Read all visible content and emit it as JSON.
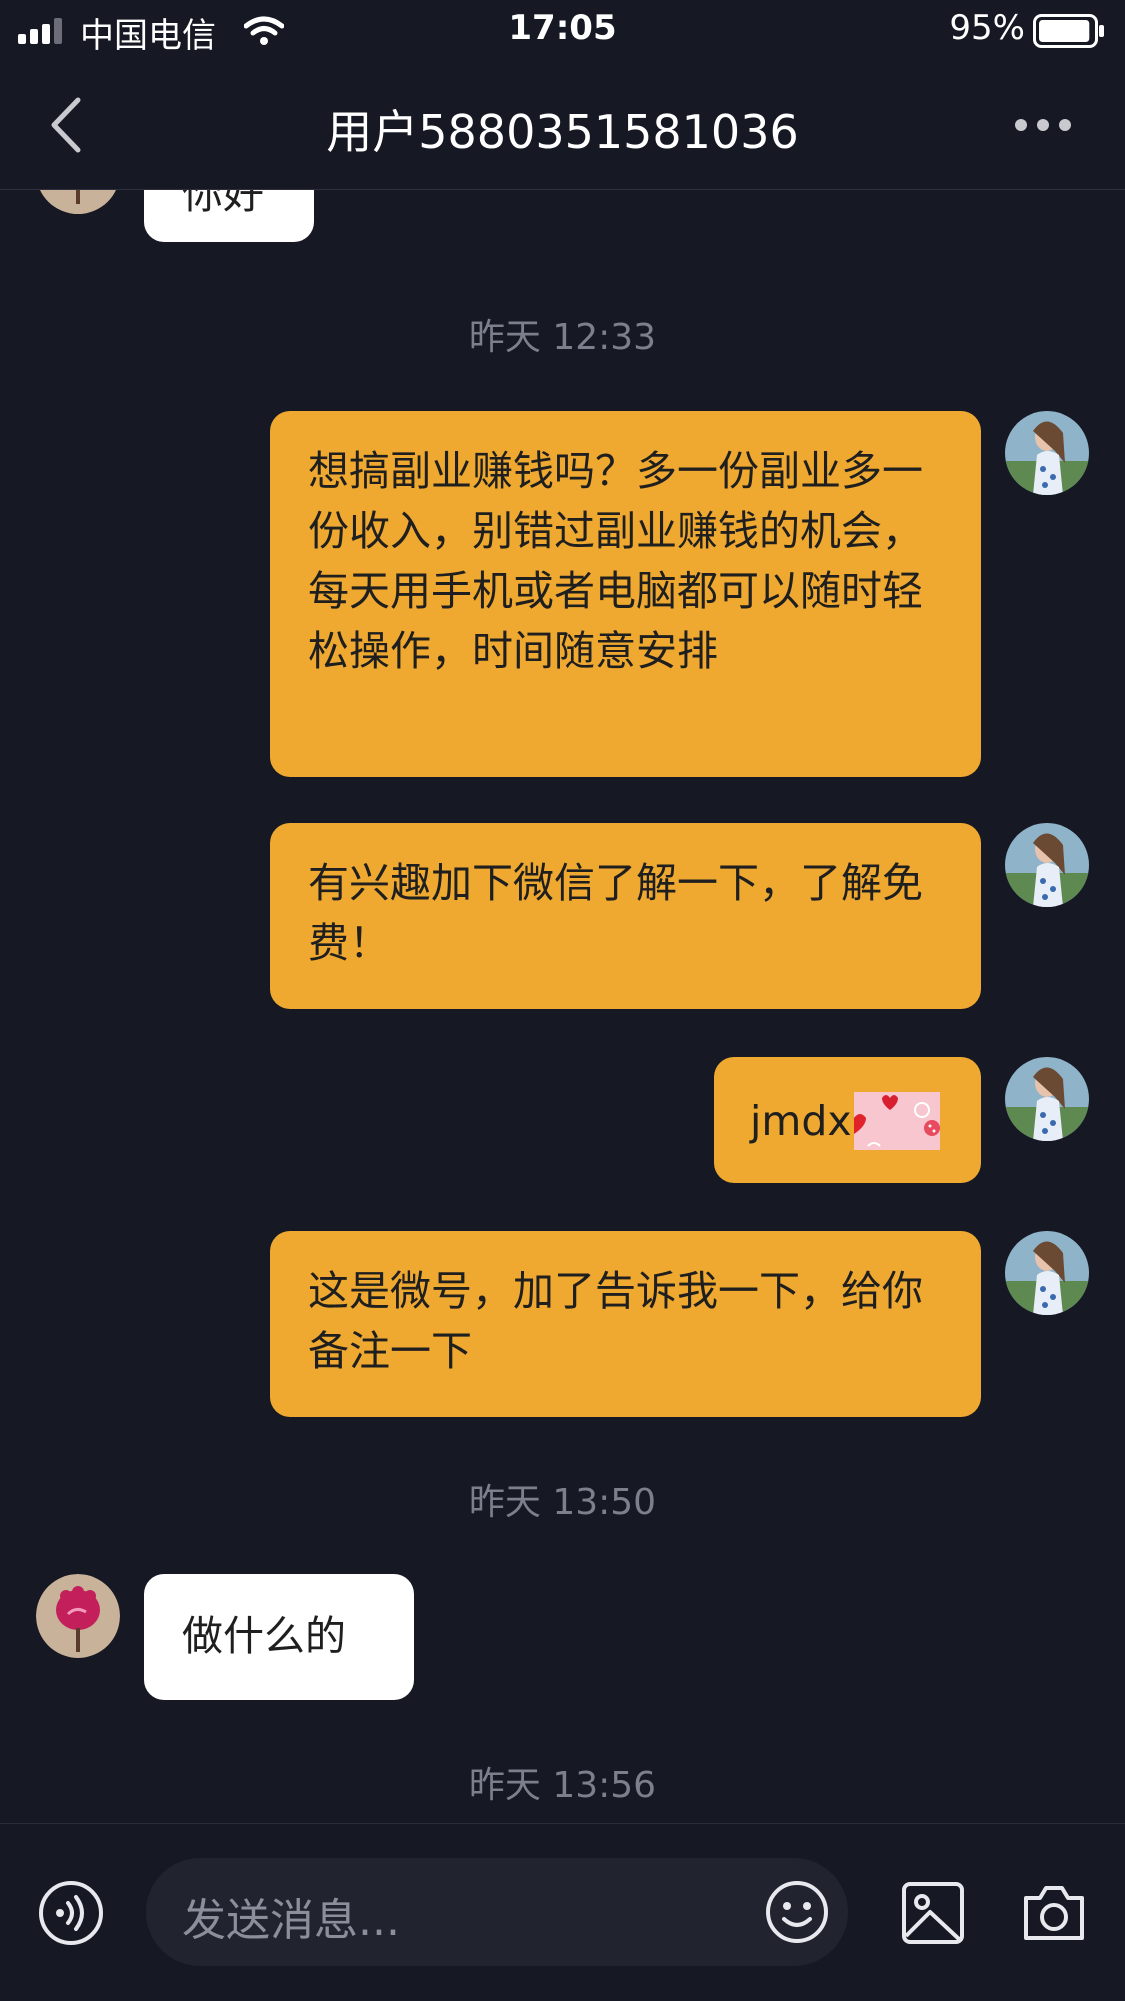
{
  "status_bar": {
    "carrier": "中国电信",
    "time": "17:05",
    "battery_percent": "95%",
    "battery_level": 0.95,
    "signal_icon": "signal-bars-icon",
    "wifi_icon": "wifi-icon"
  },
  "header": {
    "title": "用户5880351581036",
    "back_icon": "chevron-left-icon",
    "more_icon": "more-dots-icon"
  },
  "messages": [
    {
      "type": "received",
      "text": "你好"
    },
    {
      "type": "timestamp",
      "text": "昨天 12:33"
    },
    {
      "type": "sent",
      "text": "想搞副业赚钱吗？多一份副业多一份收入，别错过副业赚钱的机会，每天用手机或者电脑都可以随时轻松操作，时间随意安排"
    },
    {
      "type": "sent",
      "text": "有兴趣加下微信了解一下，了解免费！"
    },
    {
      "type": "sent",
      "text": "jmdx",
      "has_sticker": true
    },
    {
      "type": "sent",
      "text": "这是微号，加了告诉我一下，给你备注一下"
    },
    {
      "type": "timestamp",
      "text": "昨天 13:50"
    },
    {
      "type": "received",
      "text": "做什么的"
    },
    {
      "type": "timestamp",
      "text": "昨天 13:56"
    }
  ],
  "input_bar": {
    "placeholder": "发送消息...",
    "voice_icon": "voice-icon",
    "emoji_icon": "emoji-icon",
    "image_icon": "image-icon",
    "camera_icon": "camera-icon"
  },
  "colors": {
    "background": "#161823",
    "sent_bubble": "#efa930",
    "received_bubble": "#ffffff",
    "timestamp": "#7c7f8c"
  }
}
